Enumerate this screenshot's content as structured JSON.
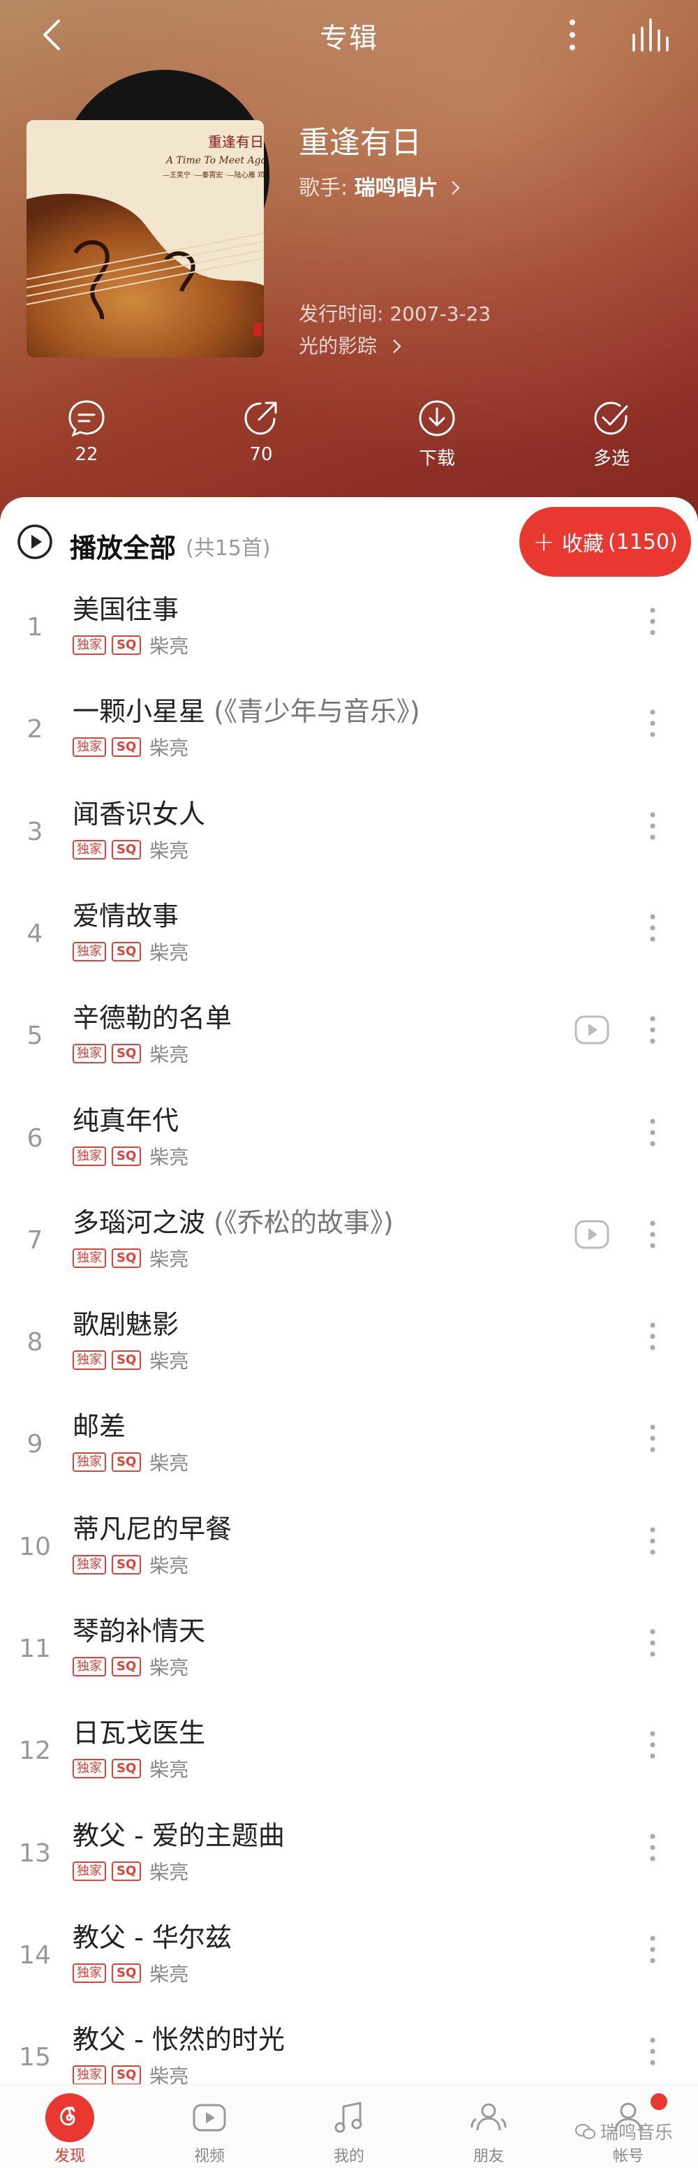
{
  "header": {
    "title": "专辑",
    "album": {
      "title": "重逢有日",
      "artist_prefix": "歌手: ",
      "artist": "瑞鸣唱片",
      "release": "发行时间: 2007-3-23",
      "label": "光的影踪"
    },
    "cover": {
      "title_cn": "重逢有日",
      "title_en": "A Time To Meet Again",
      "credits": "—王笑宁 ·—秦霄宏 ·—陆心雁 邓冠"
    },
    "actions": [
      {
        "icon": "comment-icon",
        "label": "22"
      },
      {
        "icon": "share-icon",
        "label": "70"
      },
      {
        "icon": "download-icon",
        "label": "下载"
      },
      {
        "icon": "multi-select-icon",
        "label": "多选"
      }
    ]
  },
  "list": {
    "play_all_label": "播放全部",
    "play_all_count": "(共15首)",
    "collect_label": "收藏",
    "collect_count": "(1150)",
    "badge_exclusive": "独家",
    "badge_sq": "SQ",
    "tracks": [
      {
        "num": "1",
        "title": "美国往事",
        "sub": "",
        "artist": "柴亮",
        "mv": false
      },
      {
        "num": "2",
        "title": "一颗小星星",
        "sub": " (《青少年与音乐》)",
        "artist": "柴亮",
        "mv": false
      },
      {
        "num": "3",
        "title": "闻香识女人",
        "sub": "",
        "artist": "柴亮",
        "mv": false
      },
      {
        "num": "4",
        "title": "爱情故事",
        "sub": "",
        "artist": "柴亮",
        "mv": false
      },
      {
        "num": "5",
        "title": "辛德勒的名单",
        "sub": "",
        "artist": "柴亮",
        "mv": true
      },
      {
        "num": "6",
        "title": "纯真年代",
        "sub": "",
        "artist": "柴亮",
        "mv": false
      },
      {
        "num": "7",
        "title": "多瑙河之波",
        "sub": " (《乔松的故事》)",
        "artist": "柴亮",
        "mv": true
      },
      {
        "num": "8",
        "title": "歌剧魅影",
        "sub": "",
        "artist": "柴亮",
        "mv": false
      },
      {
        "num": "9",
        "title": "邮差",
        "sub": "",
        "artist": "柴亮",
        "mv": false
      },
      {
        "num": "10",
        "title": "蒂凡尼的早餐",
        "sub": "",
        "artist": "柴亮",
        "mv": false
      },
      {
        "num": "11",
        "title": "琴韵补情天",
        "sub": "",
        "artist": "柴亮",
        "mv": false
      },
      {
        "num": "12",
        "title": "日瓦戈医生",
        "sub": "",
        "artist": "柴亮",
        "mv": false
      },
      {
        "num": "13",
        "title": "教父 - 爱的主题曲",
        "sub": "",
        "artist": "柴亮",
        "mv": false
      },
      {
        "num": "14",
        "title": "教父 - 华尔兹",
        "sub": "",
        "artist": "柴亮",
        "mv": false
      },
      {
        "num": "15",
        "title": "教父 - 怅然的时光",
        "sub": "",
        "artist": "柴亮",
        "mv": false
      }
    ]
  },
  "nav": {
    "items": [
      {
        "label": "发现",
        "icon": "netease-logo-icon",
        "active": true
      },
      {
        "label": "视频",
        "icon": "video-icon",
        "active": false
      },
      {
        "label": "我的",
        "icon": "music-note-icon",
        "active": false
      },
      {
        "label": "朋友",
        "icon": "friends-icon",
        "active": false
      },
      {
        "label": "帐号",
        "icon": "account-icon",
        "active": false
      }
    ],
    "watermark": "瑞鸣音乐"
  },
  "colors": {
    "accent": "#e8382f",
    "header_gradient_start": "#b88a63",
    "header_gradient_end": "#83281f"
  }
}
